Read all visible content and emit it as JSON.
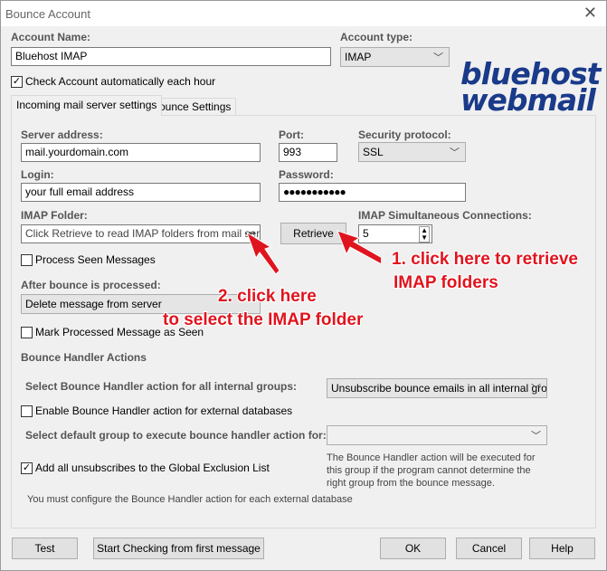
{
  "window": {
    "title": "Bounce Account"
  },
  "account": {
    "name_label": "Account Name:",
    "name_value": "Bluehost IMAP",
    "type_label": "Account type:",
    "type_value": "IMAP",
    "auto_check_label": "Check Account automatically each hour",
    "auto_check": true
  },
  "logo": {
    "line1": "bluehost",
    "line2": "webmail"
  },
  "tabs": [
    {
      "label": "Incoming mail server settings",
      "active": true
    },
    {
      "label": "Bounce Settings",
      "active": false
    }
  ],
  "server": {
    "address_label": "Server address:",
    "address_value": "mail.yourdomain.com",
    "port_label": "Port:",
    "port_value": "993",
    "security_label": "Security protocol:",
    "security_value": "SSL",
    "login_label": "Login:",
    "login_value": "your full email address",
    "password_label": "Password:",
    "password_value": "●●●●●●●●●●●",
    "folder_label": "IMAP Folder:",
    "folder_value": "Click Retrieve to read IMAP folders from mail server",
    "folder_browse": "•••",
    "retrieve_label": "Retrieve",
    "connections_label": "IMAP Simultaneous Connections:",
    "connections_value": "5",
    "process_seen_label": "Process Seen Messages",
    "process_seen": false,
    "after_label": "After bounce is processed:",
    "after_value": "Delete message from server",
    "mark_seen_label": "Mark Processed Message as Seen",
    "mark_seen": false
  },
  "handler": {
    "section_label": "Bounce Handler Actions",
    "internal_label": "Select Bounce Handler action for all internal groups:",
    "internal_value": "Unsubscribe bounce emails in all internal groups",
    "external_label": "Enable Bounce Handler action for external databases",
    "external": false,
    "default_group_label": "Select default group to execute bounce handler action for:",
    "default_group_value": "",
    "default_note": "The Bounce Handler action will be executed for this group if the program cannot determine the right group from the bounce message.",
    "exclusion_label": "Add all unsubscribes to the Global Exclusion List",
    "exclusion": true,
    "footer_note": "You must configure the Bounce Handler action for each external database"
  },
  "annotations": {
    "one_line1": "1. click here to retrieve",
    "one_line2": "IMAP folders",
    "two_line1": "2. click here",
    "two_line2": "to select the IMAP folder",
    "color": "#e0141e"
  },
  "buttons": {
    "test": "Test",
    "start": "Start Checking from first message",
    "ok": "OK",
    "cancel": "Cancel",
    "help": "Help"
  }
}
